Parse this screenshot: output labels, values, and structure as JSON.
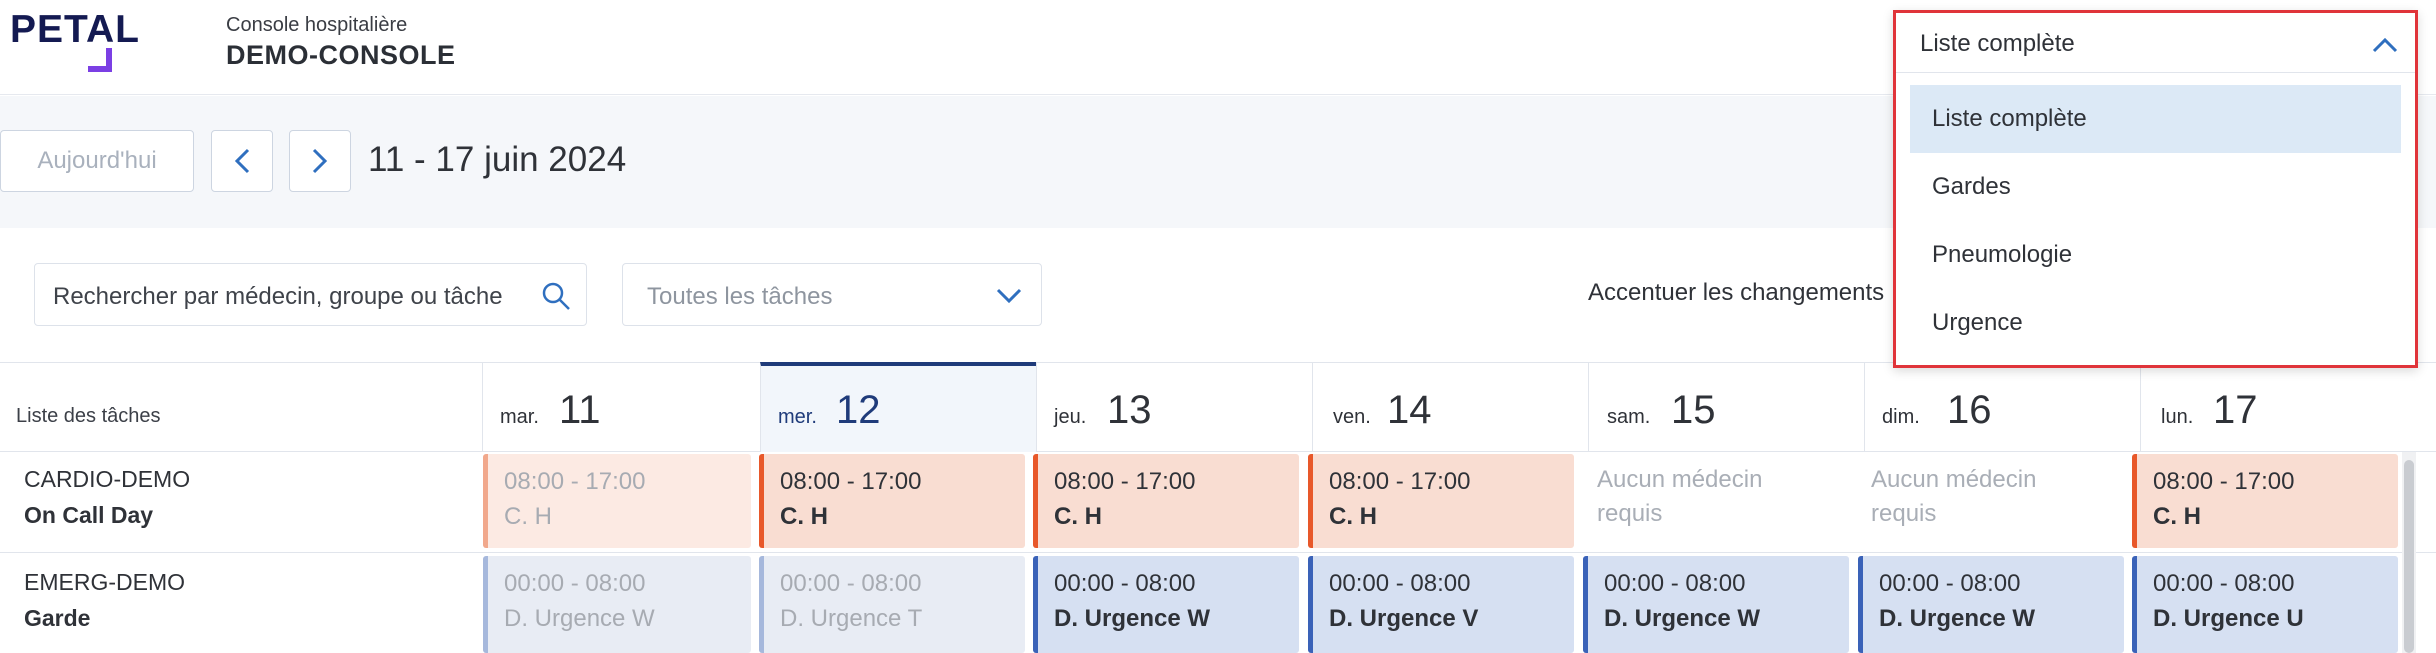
{
  "header": {
    "logo_text": "PETAL",
    "console_subtitle": "Console hospitalière",
    "console_title": "DEMO-CONSOLE"
  },
  "date_nav": {
    "today_label": "Aujourd'hui",
    "range_label": "11 - 17 juin 2024"
  },
  "filters": {
    "search_placeholder": "Rechercher par médecin, groupe ou tâche",
    "task_select_value": "Toutes les tâches",
    "accent_label": "Accentuer les changements"
  },
  "grid": {
    "task_list_label": "Liste des tâches",
    "days": [
      {
        "abbr": "mar.",
        "num": "11"
      },
      {
        "abbr": "mer.",
        "num": "12"
      },
      {
        "abbr": "jeu.",
        "num": "13"
      },
      {
        "abbr": "ven.",
        "num": "14"
      },
      {
        "abbr": "sam.",
        "num": "15"
      },
      {
        "abbr": "dim.",
        "num": "16"
      },
      {
        "abbr": "lun.",
        "num": "17"
      }
    ],
    "rows": [
      {
        "title": "CARDIO-DEMO",
        "subtitle": "On Call Day",
        "cells": [
          {
            "time": "08:00 - 17:00",
            "name": "C. H"
          },
          {
            "time": "08:00 - 17:00",
            "name": "C. H"
          },
          {
            "time": "08:00 - 17:00",
            "name": "C. H"
          },
          {
            "time": "08:00 - 17:00",
            "name": "C. H"
          },
          {
            "line1": "Aucun médecin",
            "line2": "requis"
          },
          {
            "line1": "Aucun médecin",
            "line2": "requis"
          },
          {
            "time": "08:00 - 17:00",
            "name": "C. H"
          }
        ]
      },
      {
        "title": "EMERG-DEMO",
        "subtitle": "Garde",
        "cells": [
          {
            "time": "00:00 - 08:00",
            "name": "D. Urgence W"
          },
          {
            "time": "00:00 - 08:00",
            "name": "D. Urgence T"
          },
          {
            "time": "00:00 - 08:00",
            "name": "D. Urgence W"
          },
          {
            "time": "00:00 - 08:00",
            "name": "D. Urgence V"
          },
          {
            "time": "00:00 - 08:00",
            "name": "D. Urgence W"
          },
          {
            "time": "00:00 - 08:00",
            "name": "D. Urgence W"
          },
          {
            "time": "00:00 - 08:00",
            "name": "D. Urgence U"
          }
        ]
      }
    ]
  },
  "dropdown": {
    "selected": "Liste complète",
    "options": [
      "Liste complète",
      "Gardes",
      "Pneumologie",
      "Urgence"
    ]
  },
  "colors": {
    "brand_navy": "#141a52",
    "brand_purple": "#7b3fe4",
    "cardio_accent": "#e8582a",
    "emerg_accent": "#3a62b8",
    "highlight_border": "#e0343a"
  }
}
